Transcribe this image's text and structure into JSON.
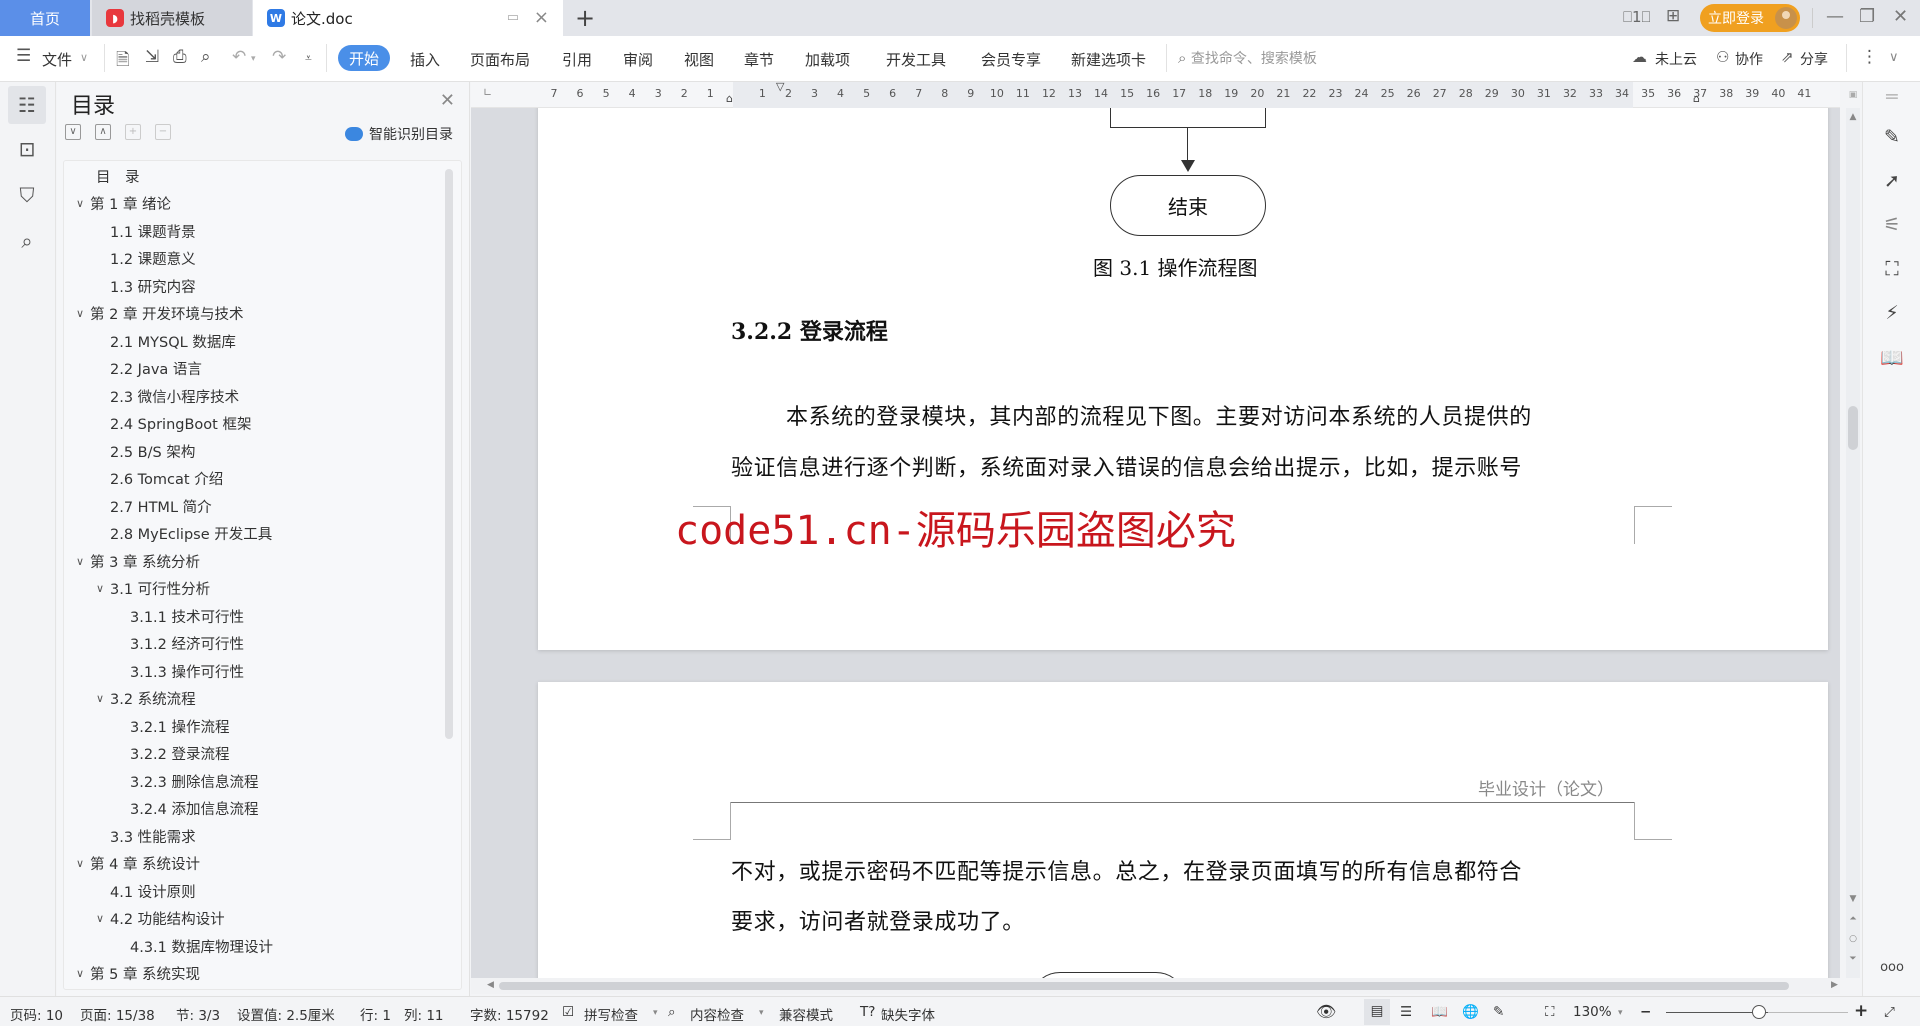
{
  "tabs": {
    "home": "首页",
    "daoke": "找稻壳模板",
    "doc": "论文.doc",
    "add": "+"
  },
  "titlebar": {
    "login": "立即登录",
    "minimize": "—",
    "restore": "❐",
    "close": "✕"
  },
  "toolbar": {
    "file": "文件",
    "menu_tabs": [
      "开始",
      "插入",
      "页面布局",
      "引用",
      "审阅",
      "视图",
      "章节",
      "加载项",
      "开发工具",
      "会员专享",
      "新建选项卡"
    ],
    "search_placeholder": "查找命令、搜索模板",
    "cloud": "未上云",
    "collab": "协作",
    "share": "分享"
  },
  "toc": {
    "title": "目录",
    "smart_label": "智能识别目录",
    "items": [
      {
        "label": "目　录",
        "level": 0,
        "chevron": false
      },
      {
        "label": "第 1 章  绪论",
        "level": 0,
        "chevron": true
      },
      {
        "label": "1.1  课题背景",
        "level": 1,
        "chevron": false
      },
      {
        "label": "1.2  课题意义",
        "level": 1,
        "chevron": false
      },
      {
        "label": "1.3  研究内容",
        "level": 1,
        "chevron": false
      },
      {
        "label": "第 2 章  开发环境与技术",
        "level": 0,
        "chevron": true
      },
      {
        "label": "2.1 MYSQL 数据库",
        "level": 1,
        "chevron": false
      },
      {
        "label": "2.2 Java 语言",
        "level": 1,
        "chevron": false
      },
      {
        "label": "2.3  微信小程序技术",
        "level": 1,
        "chevron": false
      },
      {
        "label": "2.4 SpringBoot 框架",
        "level": 1,
        "chevron": false
      },
      {
        "label": "2.5 B/S 架构",
        "level": 1,
        "chevron": false
      },
      {
        "label": "2.6 Tomcat  介绍",
        "level": 1,
        "chevron": false
      },
      {
        "label": "2.7 HTML 简介",
        "level": 1,
        "chevron": false
      },
      {
        "label": "2.8 MyEclipse 开发工具",
        "level": 1,
        "chevron": false
      },
      {
        "label": "第 3 章  系统分析",
        "level": 0,
        "chevron": true
      },
      {
        "label": "3.1  可行性分析",
        "level": 1,
        "chevron": true
      },
      {
        "label": "3.1.1  技术可行性",
        "level": 2,
        "chevron": false
      },
      {
        "label": "3.1.2  经济可行性",
        "level": 2,
        "chevron": false
      },
      {
        "label": "3.1.3  操作可行性",
        "level": 2,
        "chevron": false
      },
      {
        "label": "3.2  系统流程",
        "level": 1,
        "chevron": true
      },
      {
        "label": "3.2.1  操作流程",
        "level": 2,
        "chevron": false
      },
      {
        "label": "3.2.2  登录流程",
        "level": 2,
        "chevron": false
      },
      {
        "label": "3.2.3  删除信息流程",
        "level": 2,
        "chevron": false
      },
      {
        "label": "3.2.4  添加信息流程",
        "level": 2,
        "chevron": false
      },
      {
        "label": "3.3  性能需求",
        "level": 1,
        "chevron": false
      },
      {
        "label": "第 4 章  系统设计",
        "level": 0,
        "chevron": true
      },
      {
        "label": "4.1  设计原则",
        "level": 1,
        "chevron": false
      },
      {
        "label": "4.2  功能结构设计",
        "level": 1,
        "chevron": true
      },
      {
        "label": "4.3.1  数据库物理设计",
        "level": 2,
        "chevron": false
      },
      {
        "label": "第 5 章  系统实现",
        "level": 0,
        "chevron": true
      }
    ]
  },
  "ruler": {
    "ticks": [
      "7",
      "6",
      "5",
      "4",
      "3",
      "2",
      "1",
      "",
      "1",
      "2",
      "3",
      "4",
      "5",
      "6",
      "7",
      "8",
      "9",
      "10",
      "11",
      "12",
      "13",
      "14",
      "15",
      "16",
      "17",
      "18",
      "19",
      "20",
      "21",
      "22",
      "23",
      "24",
      "25",
      "26",
      "27",
      "28",
      "29",
      "30",
      "31",
      "32",
      "33",
      "34",
      "35",
      "36",
      "37",
      "38",
      "39",
      "40",
      "41"
    ]
  },
  "document": {
    "flow_end_label": "结束",
    "figure_caption": "图 3.1  操作流程图",
    "heading": "3.2.2  登录流程",
    "para1_line1": "本系统的登录模块，其内部的流程见下图。主要对访问本系统的人员提供的",
    "para1_line2": "验证信息进行逐个判断，系统面对录入错误的信息会给出提示，比如，提示账号",
    "watermark": "code51.cn-源码乐园盗图必究",
    "page2_header": "毕业设计（论文）",
    "para2_line1": "不对，或提示密码不匹配等提示信息。总之，在登录页面填写的所有信息都符合",
    "para2_line2": "要求，访问者就登录成功了。"
  },
  "statusbar": {
    "page_no": "页码: 10",
    "pages": "页面: 15/38",
    "section": "节: 3/3",
    "setting": "设置值: 2.5厘米",
    "row": "行: 1",
    "col": "列: 11",
    "word_count": "字数: 15792",
    "spell_check": "拼写检查",
    "content_check": "内容检查",
    "compat_mode": "兼容模式",
    "missing_font": "缺失字体",
    "zoom": "130%",
    "zoom_level_percent": 130
  },
  "colors": {
    "accent": "#4a8fe8",
    "home_tab": "#5b8fe8",
    "login": "#f0a020",
    "watermark": "#c8161d"
  }
}
